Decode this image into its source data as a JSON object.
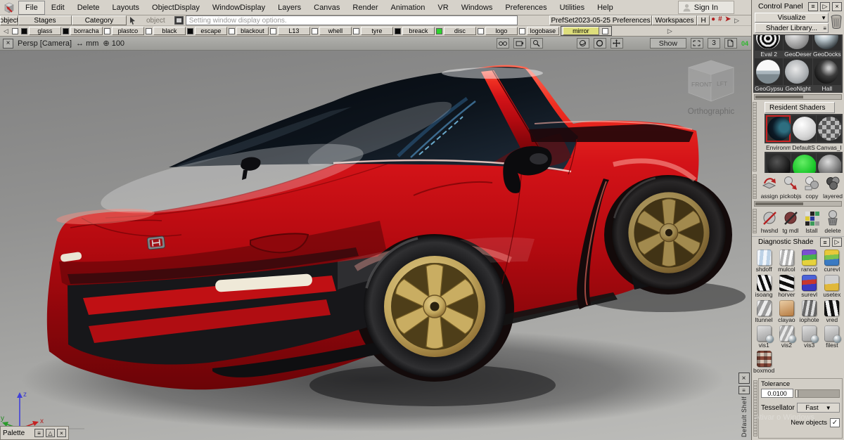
{
  "menu_bar": {
    "items": [
      "File",
      "Edit",
      "Delete",
      "Layouts",
      "ObjectDisplay",
      "WindowDisplay",
      "Layers",
      "Canvas",
      "Render",
      "Animation",
      "VR",
      "Windows",
      "Preferences",
      "Utilities",
      "Help"
    ],
    "sign_in_label": "Sign In"
  },
  "tab_row": {
    "tab_object": "object",
    "tab_stages": "Stages",
    "tab_category": "Category",
    "pick_label": "object",
    "display_field_placeholder": "Setting window display options.",
    "prefset_label": "PrefSet2023-05-25 Preferences",
    "workspaces_label": "Workspaces",
    "m_icon_label": "H"
  },
  "shelf_row": {
    "items": [
      {
        "label": "glass",
        "swatch": "#0a0a0a"
      },
      {
        "label": "borracha",
        "swatch": "#0a0a0a"
      },
      {
        "label": "plastco",
        "swatch": "#ffffff"
      },
      {
        "label": "black",
        "swatch": "#ffffff"
      },
      {
        "label": "escape",
        "swatch": "#0a0a0a"
      },
      {
        "label": "blackout",
        "swatch": "#ffffff"
      },
      {
        "label": "L13",
        "swatch": "#ffffff"
      },
      {
        "label": "whell",
        "swatch": "#ffffff"
      },
      {
        "label": "tyre",
        "swatch": "#ffffff"
      },
      {
        "label": "breack",
        "swatch": "#0a0a0a"
      },
      {
        "label": "disc",
        "swatch": "#2ed32e"
      },
      {
        "label": "logo",
        "swatch": "#ffffff"
      },
      {
        "label": "logobase",
        "swatch": "#ffffff"
      }
    ],
    "mirror_label": "mirror",
    "mirror_highlight": "#dede7c"
  },
  "viewport_bar": {
    "camera_label": "Persp [Camera]",
    "units_label": "↔ mm",
    "zoom_label": "⊕ 100",
    "show_label": "Show",
    "count_label": "3",
    "fps_label": "04"
  },
  "viewport": {
    "viewcube": {
      "front_label": "FRONT",
      "side_label": "LFT",
      "projection_label": "Orthographic"
    },
    "axes": {
      "x": "x",
      "y": "y",
      "z": "z"
    },
    "default_shelf_label": "Default Shelf",
    "palette_title": "Palette",
    "watermark": "Ativar o Windows"
  },
  "control_panel": {
    "title": "Control Panel",
    "visualize_label": "Visualize",
    "shader_library_label": "Shader Library...",
    "library_shaders": [
      "Eval 2",
      "GeoDeser",
      "GeoDocks",
      "GeoGypsu",
      "GeoNight",
      "Hall"
    ],
    "resident_header": "Resident Shaders",
    "resident_shaders": [
      "Environm",
      "DefaultS",
      "Canvas_R"
    ],
    "shader_tools": [
      "assign",
      "pickobjs",
      "copy",
      "layered"
    ],
    "shader_tools2": [
      "hwshd",
      "tg mdl",
      "lstall",
      "delete"
    ],
    "diagnostic_header": "Diagnostic Shade",
    "diagnostic_tools": [
      "shdoff",
      "mulcol",
      "rancol",
      "curevl",
      "isoang",
      "horver",
      "surevl",
      "usetex",
      "ltunnel",
      "clayao",
      "iophote",
      "vred",
      "vis1",
      "vis2",
      "vis3",
      "filest",
      "boxmod"
    ],
    "tolerance_label": "Tolerance",
    "tolerance_value": "0.0100",
    "tessellator_label": "Tessellator",
    "tessellator_value": "Fast",
    "new_objects_label": "New objects"
  },
  "colors": {
    "body_red": "#c00d12",
    "wheel_gold": "#b5995a",
    "selection_yellow": "#dede7c",
    "swatch_green": "#2ed32e",
    "viewport_top": "#828282",
    "viewport_bottom": "#bdbdba"
  }
}
